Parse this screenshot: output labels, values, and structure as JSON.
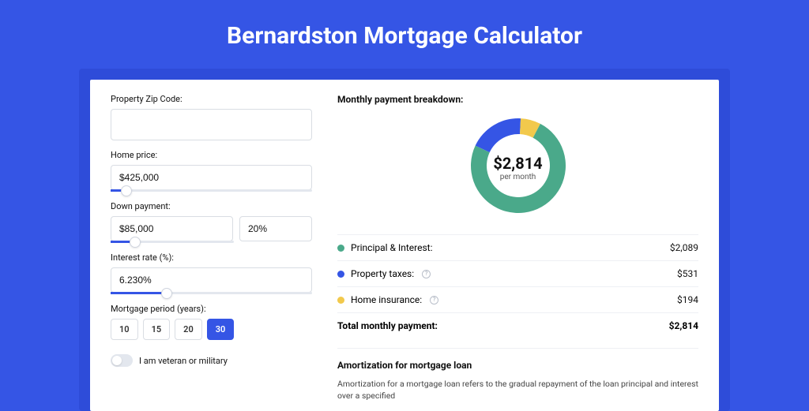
{
  "title": "Bernardston Mortgage Calculator",
  "form": {
    "zip_label": "Property Zip Code:",
    "zip_value": "",
    "home_price_label": "Home price:",
    "home_price_value": "$425,000",
    "home_price_slider_pct": 8,
    "down_label": "Down payment:",
    "down_value": "$85,000",
    "down_pct_value": "20%",
    "down_slider_pct": 20,
    "rate_label": "Interest rate (%):",
    "rate_value": "6.230%",
    "rate_slider_pct": 28,
    "period_label": "Mortgage period (years):",
    "periods": [
      "10",
      "15",
      "20",
      "30"
    ],
    "period_active_index": 3,
    "veteran_label": "I am veteran or military"
  },
  "breakdown": {
    "heading": "Monthly payment breakdown:",
    "center_value": "$2,814",
    "center_sub": "per month",
    "items": [
      {
        "label": "Principal & Interest:",
        "value": "$2,089",
        "color": "#4aa98a",
        "info": false
      },
      {
        "label": "Property taxes:",
        "value": "$531",
        "color": "#3555e5",
        "info": true
      },
      {
        "label": "Home insurance:",
        "value": "$194",
        "color": "#f2c94c",
        "info": true
      }
    ],
    "total_label": "Total monthly payment:",
    "total_value": "$2,814"
  },
  "amort": {
    "heading": "Amortization for mortgage loan",
    "text": "Amortization for a mortgage loan refers to the gradual repayment of the loan principal and interest over a specified"
  },
  "chart_data": {
    "type": "pie",
    "title": "Monthly payment breakdown",
    "series": [
      {
        "name": "Principal & Interest",
        "value": 2089,
        "color": "#4aa98a"
      },
      {
        "name": "Property taxes",
        "value": 531,
        "color": "#3555e5"
      },
      {
        "name": "Home insurance",
        "value": 194,
        "color": "#f2c94c"
      }
    ],
    "total": 2814,
    "unit": "USD per month"
  }
}
